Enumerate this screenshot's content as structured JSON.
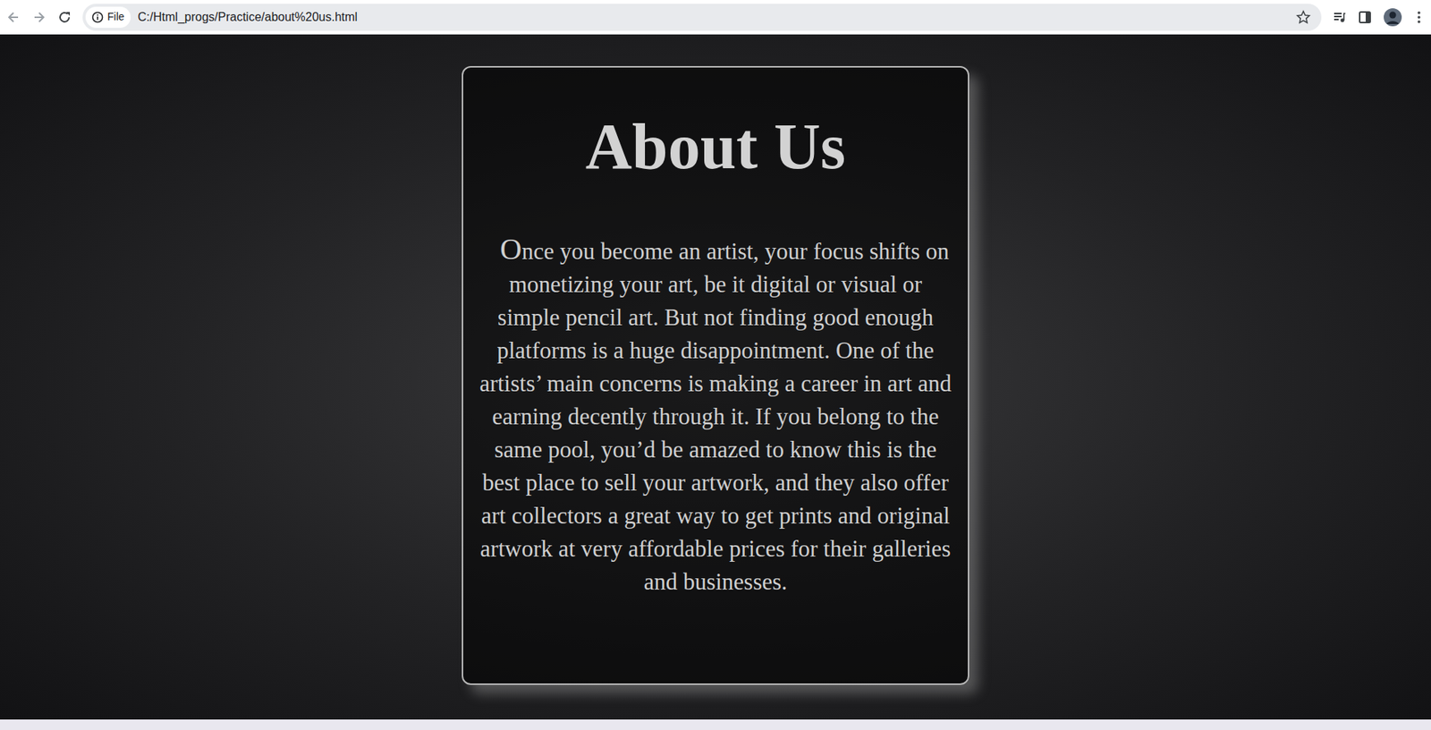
{
  "browser": {
    "badge": "File",
    "address": "C:/Html_progs/Practice/about%20us.html"
  },
  "page": {
    "heading": "About Us",
    "paragraph": "Once you become an artist, your focus shifts on monetizing your art, be it digital or visual or simple pencil art. But not finding good enough platforms is a huge disappointment. One of the artists’ main concerns is making a career in art and earning decently through it. If you belong to the same pool, you’d be amazed to know this is the best place to sell your artwork, and they also offer art collectors a great way to get prints and original artwork at very affordable prices for their galleries and businesses."
  }
}
